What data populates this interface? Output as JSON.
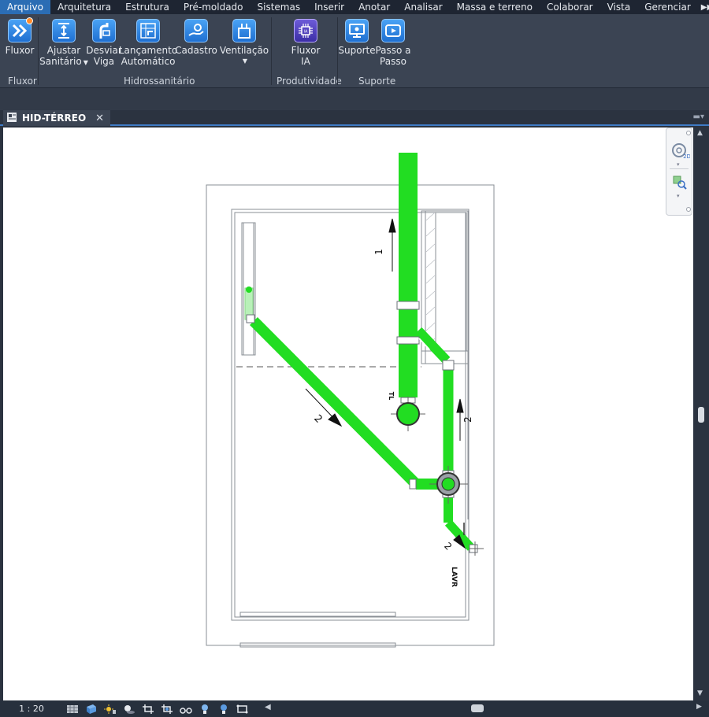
{
  "menubar": {
    "items": [
      "Arquivo",
      "Arquitetura",
      "Estrutura",
      "Pré-moldado",
      "Sistemas",
      "Inserir",
      "Anotar",
      "Analisar",
      "Massa e terreno",
      "Colaborar",
      "Vista",
      "Gerenciar"
    ],
    "active": "Arquivo"
  },
  "ribbon": {
    "panels": {
      "fluxor": {
        "title": "Fluxor"
      },
      "hidrossanitario": {
        "title": "Hidrossanitário"
      },
      "produtividade": {
        "title": "Produtividade"
      },
      "suporte": {
        "title": "Suporte"
      }
    },
    "tools": {
      "fluxor": {
        "line1": "Fluxor"
      },
      "ajustar": {
        "line1": "Ajustar",
        "line2": "Sanitário"
      },
      "desviar": {
        "line1": "Desviar",
        "line2": "Viga"
      },
      "lancamento": {
        "line1": "Lançamento",
        "line2": "Automático"
      },
      "cadastro": {
        "line1": "Cadastro"
      },
      "ventilacao": {
        "line1": "Ventilação"
      },
      "fluxor_ia": {
        "line1": "Fluxor",
        "line2": "IA"
      },
      "suporte": {
        "line1": "Suporte"
      },
      "passo": {
        "line1": "Passo a",
        "line2": "Passo"
      }
    }
  },
  "document_tab": {
    "title": "HID-TÉRREO",
    "close": "✕"
  },
  "drawing": {
    "pipe_labels": [
      "1",
      "2",
      "2",
      "2"
    ],
    "fixture_label": "LAVR",
    "drain_label": "TL",
    "pipe_color": "#22dd22"
  },
  "statusbar": {
    "scale": "1 : 20"
  }
}
